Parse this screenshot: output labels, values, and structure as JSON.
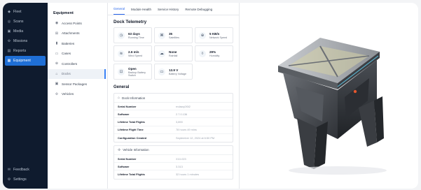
{
  "nav": {
    "top_label": "Fleet",
    "items": [
      {
        "label": "Scans",
        "icon": "scan-icon"
      },
      {
        "label": "Media",
        "icon": "image-icon"
      },
      {
        "label": "Missions",
        "icon": "route-icon"
      },
      {
        "label": "Reports",
        "icon": "document-icon"
      },
      {
        "label": "Equipment",
        "icon": "equipment-icon",
        "active": true
      }
    ],
    "bottom": [
      {
        "label": "Feedback"
      },
      {
        "label": "Settings"
      }
    ]
  },
  "sub": {
    "title": "Equipment",
    "items": [
      {
        "label": "Access Points"
      },
      {
        "label": "Attachments"
      },
      {
        "label": "Batteries"
      },
      {
        "label": "Cases"
      },
      {
        "label": "Controllers"
      },
      {
        "label": "Docks",
        "active": true
      },
      {
        "label": "Sensor Packages"
      },
      {
        "label": "Vehicles"
      }
    ]
  },
  "tabs": [
    "General",
    "Module Health",
    "Service History",
    "Remote Debugging"
  ],
  "telemetry": {
    "title": "Dock Telemetry",
    "cards": [
      {
        "value": "63 days",
        "label": "Running Time",
        "icon": "clock-icon"
      },
      {
        "value": "35",
        "label": "Satellites",
        "icon": "satellite-icon"
      },
      {
        "value": "5 KB/s",
        "label": "Network Speed",
        "icon": "globe-icon"
      },
      {
        "value": "2.6 m/s",
        "label": "Wind Speed",
        "icon": "wind-icon"
      },
      {
        "value": "None",
        "label": "Rainfall",
        "icon": "cloud-icon"
      },
      {
        "value": "29%",
        "label": "Humidity",
        "icon": "droplet-icon"
      },
      {
        "value": "Open",
        "label": "Backup Battery Switch",
        "icon": "battery-switch-icon"
      },
      {
        "value": "13.9 V",
        "label": "Battery Voltage",
        "icon": "battery-icon"
      }
    ]
  },
  "general": {
    "title": "General",
    "dock_info": {
      "title": "Dock Information",
      "rows": [
        {
          "key": "Serial Number",
          "value": "rndawy2l0l2"
        },
        {
          "key": "Software",
          "value": "2.7.0.136"
        },
        {
          "key": "Lifetime Total Flights",
          "value": "3,890"
        },
        {
          "key": "Lifetime Flight Time",
          "value": "78 hours 49 mins"
        },
        {
          "key": "Configuration Created",
          "value": "September 12, 2024 at 6:50 PM"
        }
      ]
    },
    "vehicle_info": {
      "title": "Vehicle Information",
      "rows": [
        {
          "key": "Serial Number",
          "value": "X10-023"
        },
        {
          "key": "Software",
          "value": "3.313"
        },
        {
          "key": "Lifetime Total Flights",
          "value": "32 hours 1 minutes"
        }
      ]
    }
  }
}
